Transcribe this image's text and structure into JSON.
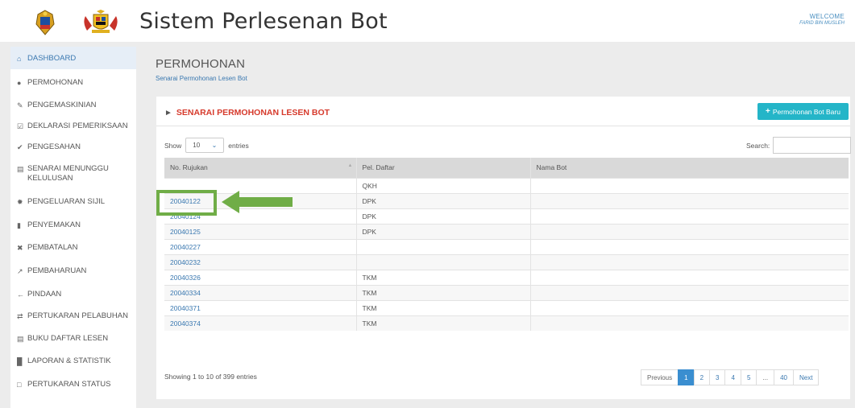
{
  "header": {
    "title": "Sistem Perlesenan Bot",
    "welcome": "WELCOME",
    "user": "FARID BIN MUSLEH"
  },
  "sidebar": {
    "items": [
      {
        "label": "DASHBOARD",
        "icon": "home-icon"
      },
      {
        "label": "PERMOHONAN",
        "icon": "user-icon"
      },
      {
        "label": "PENGEMASKINIAN",
        "icon": "pencil-icon"
      },
      {
        "label": "DEKLARASI PEMERIKSAAN",
        "icon": "checkbox-icon"
      },
      {
        "label": "PENGESAHAN",
        "icon": "check-icon"
      },
      {
        "label": "SENARAI MENUNGGU KELULUSAN",
        "icon": "document-icon"
      },
      {
        "label": "PENGELUARAN SIJIL",
        "icon": "certificate-icon"
      },
      {
        "label": "PENYEMAKAN",
        "icon": "bookmark-icon"
      },
      {
        "label": "PEMBATALAN",
        "icon": "close-icon"
      },
      {
        "label": "PEMBAHARUAN",
        "icon": "external-link-icon"
      },
      {
        "label": "PINDAAN",
        "icon": "arrow-left-icon"
      },
      {
        "label": "PERTUKARAN PELABUHAN",
        "icon": "exchange-icon"
      },
      {
        "label": "BUKU DAFTAR LESEN",
        "icon": "book-icon"
      },
      {
        "label": "LAPORAN & STATISTIK",
        "icon": "bar-chart-icon"
      },
      {
        "label": "PERTUKARAN STATUS",
        "icon": "file-icon"
      }
    ]
  },
  "page": {
    "title": "PERMOHONAN",
    "subtitle": "Senarai Permohonan Lesen Bot"
  },
  "panel": {
    "title": "SENARAI PERMOHONAN LESEN BOT",
    "new_button": "Permohonan Bot Baru",
    "show_label": "Show",
    "entries_value": "10",
    "entries_label": "entries",
    "search_label": "Search:",
    "columns": [
      "No. Rujukan",
      "Pel. Daftar",
      "Nama Bot"
    ],
    "rows": [
      {
        "rujukan": "",
        "pel": "QKH",
        "nama": ""
      },
      {
        "rujukan": "20040122",
        "pel": "DPK",
        "nama": ""
      },
      {
        "rujukan": "20040124",
        "pel": "DPK",
        "nama": ""
      },
      {
        "rujukan": "20040125",
        "pel": "DPK",
        "nama": ""
      },
      {
        "rujukan": "20040227",
        "pel": "",
        "nama": ""
      },
      {
        "rujukan": "20040232",
        "pel": "",
        "nama": ""
      },
      {
        "rujukan": "20040326",
        "pel": "TKM",
        "nama": ""
      },
      {
        "rujukan": "20040334",
        "pel": "TKM",
        "nama": ""
      },
      {
        "rujukan": "20040371",
        "pel": "TKM",
        "nama": ""
      },
      {
        "rujukan": "20040374",
        "pel": "TKM",
        "nama": ""
      }
    ],
    "info": "Showing 1 to 10 of 399 entries",
    "pagination": [
      "Previous",
      "1",
      "2",
      "3",
      "4",
      "5",
      "...",
      "40",
      "Next"
    ]
  },
  "colors": {
    "accent": "#3a78b0",
    "title_red": "#d63a2c",
    "button_teal": "#24b5c8",
    "highlight_green": "#70ad47"
  }
}
